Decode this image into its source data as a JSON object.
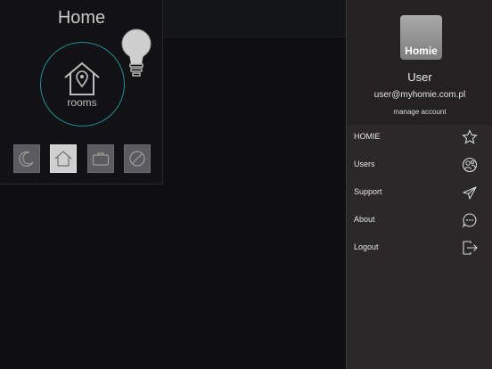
{
  "home": {
    "title": "Home",
    "rooms_label": "rooms",
    "modes": [
      {
        "icon": "moon-icon",
        "active": false
      },
      {
        "icon": "home-icon",
        "active": true
      },
      {
        "icon": "briefcase-icon",
        "active": false
      },
      {
        "icon": "disabled-icon",
        "active": false
      }
    ]
  },
  "drawer": {
    "logo_text": "Homie",
    "user_name": "User",
    "user_email": "user@myhomie.com.pl",
    "manage_account": "manage account",
    "menu": [
      {
        "label": "HOMIE",
        "icon": "star-icon"
      },
      {
        "label": "Users",
        "icon": "users-icon"
      },
      {
        "label": "Support",
        "icon": "send-icon"
      },
      {
        "label": "About",
        "icon": "chat-icon"
      },
      {
        "label": "Logout",
        "icon": "logout-icon"
      }
    ]
  },
  "colors": {
    "accent": "#1f8e9b",
    "background": "#0f0f11",
    "drawer": "#2a2829"
  }
}
